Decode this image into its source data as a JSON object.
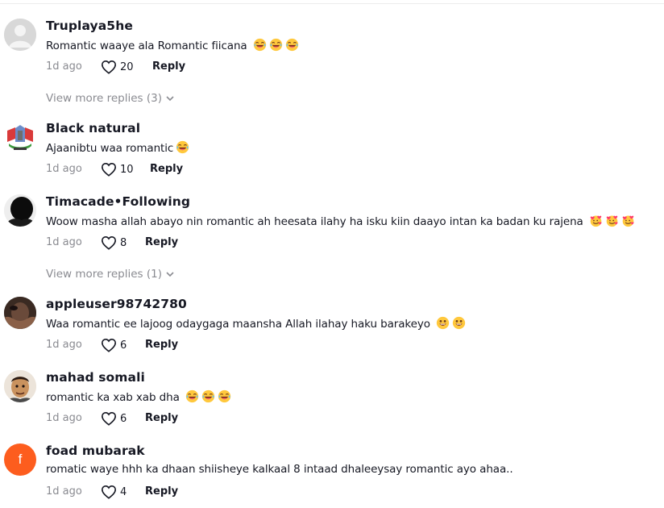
{
  "comments": [
    {
      "username": "Truplaya5he",
      "text": "Romantic waaye ala Romantic fiicana",
      "date": "1d ago",
      "likes": "20",
      "reply": "Reply",
      "view_more": "View more replies (3)",
      "emojis": [
        "laugh",
        "laugh",
        "laugh"
      ]
    },
    {
      "username": "Black natural",
      "text": "Ajaanibtu waa romantic",
      "date": "1d ago",
      "likes": "10",
      "reply": "Reply",
      "emojis": [
        "laugh"
      ]
    },
    {
      "username": "Timacade•Following",
      "text": "Woow masha allah abayo nin romantic ah heesata ilahy ha isku kiin daayo intan ka badan ku rajena",
      "date": "1d ago",
      "likes": "8",
      "reply": "Reply",
      "view_more": "View more replies (1)",
      "emojis": [
        "hearts",
        "hearts",
        "hearts"
      ]
    },
    {
      "username": "appleuser98742780",
      "text": "Waa romantic ee lajoog odaygaga maansha Allah ilahay haku barakeyo",
      "date": "1d ago",
      "likes": "6",
      "reply": "Reply",
      "emojis": [
        "grin",
        "grin"
      ]
    },
    {
      "username": "mahad somali",
      "text": "romantic ka xab xab dha",
      "date": "1d ago",
      "likes": "6",
      "reply": "Reply",
      "emojis": [
        "laugh",
        "laugh",
        "laugh"
      ]
    },
    {
      "username": "foad mubarak",
      "text": "romatic waye hhh ka dhaan shiisheye kalkaal 8 intaad dhaleeysay romantic ayo ahaa..",
      "date": "1d ago",
      "likes": "4",
      "reply": "Reply",
      "avatar_letter": "f",
      "emojis": []
    }
  ],
  "colors": {
    "accent": "#fe2c55",
    "muted": "#8a8b91",
    "text": "#161823",
    "avatar_letter_bg": "#fd5d1e"
  }
}
